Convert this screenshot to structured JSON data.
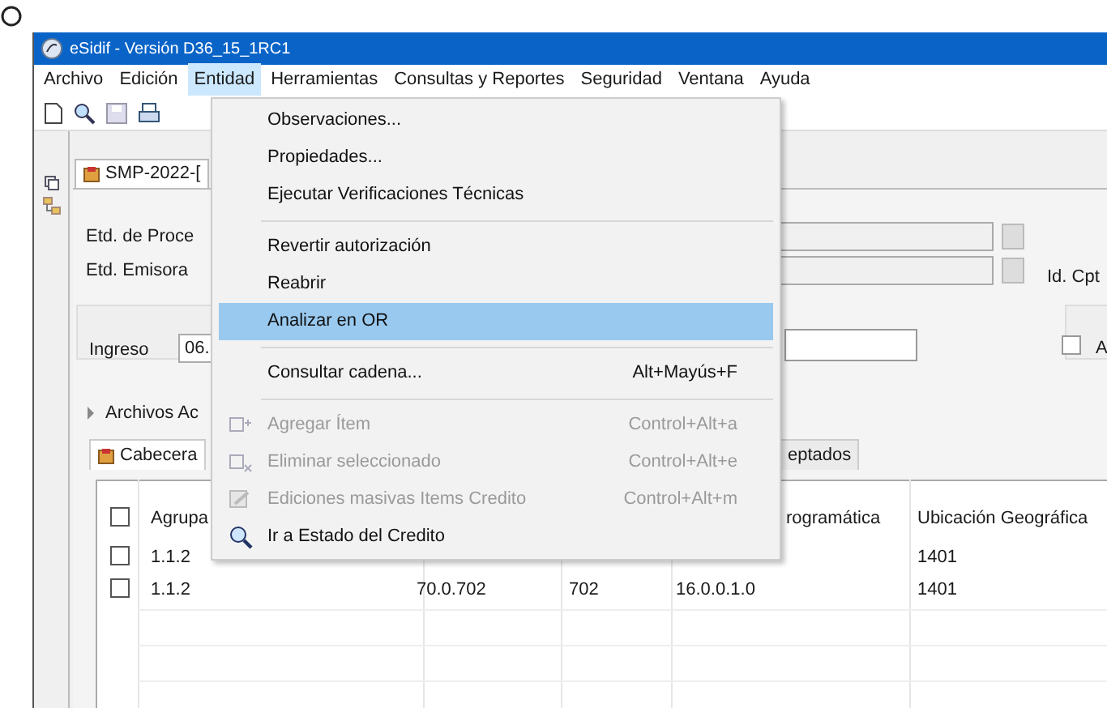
{
  "window": {
    "title": "eSidif - Versión D36_15_1RC1"
  },
  "menu_bar": [
    {
      "label": "Archivo",
      "selected": false
    },
    {
      "label": "Edición",
      "selected": false
    },
    {
      "label": "Entidad",
      "selected": true
    },
    {
      "label": "Herramientas",
      "selected": false
    },
    {
      "label": "Consultas y Reportes",
      "selected": false
    },
    {
      "label": "Seguridad",
      "selected": false
    },
    {
      "label": "Ventana",
      "selected": false
    },
    {
      "label": "Ayuda",
      "selected": false
    }
  ],
  "document_tab": {
    "label": "SMP-2022-["
  },
  "form": {
    "label_1": "Etd. de Proce",
    "label_2": "Etd. Emisora",
    "label_3": "Id. Cpt",
    "ingreso_label": "Ingreso",
    "ingreso_value": "06.",
    "checkbox": {
      "label": "A",
      "checked": false
    }
  },
  "attachments": {
    "label": "Archivos Ac",
    "expanded": false
  },
  "tabs": [
    {
      "label": "Cabecera",
      "selected": true
    },
    {
      "label": "eptados",
      "selected": false
    }
  ],
  "table": {
    "header_checked": false,
    "columns": [
      "Agrupa",
      "",
      "",
      "rogramática",
      "Ubicación Geográfica"
    ],
    "rows": [
      {
        "checked": false,
        "cells": [
          "1.1.2",
          "",
          "",
          "",
          "1401"
        ]
      },
      {
        "checked": false,
        "cells": [
          "1.1.2",
          "70.0.702",
          "702",
          "16.0.0.1.0",
          "1401"
        ]
      }
    ]
  },
  "dropdown": [
    {
      "kind": "item",
      "label": "Observaciones...",
      "selected": false,
      "disabled": false
    },
    {
      "kind": "item",
      "label": "Propiedades...",
      "selected": false,
      "disabled": false
    },
    {
      "kind": "item",
      "label": "Ejecutar Verificaciones Técnicas",
      "selected": false,
      "disabled": false
    },
    {
      "kind": "separator"
    },
    {
      "kind": "item",
      "label": "Revertir autorización",
      "selected": false,
      "disabled": false
    },
    {
      "kind": "item",
      "label": "Reabrir",
      "selected": false,
      "disabled": false
    },
    {
      "kind": "item",
      "label": "Analizar en OR",
      "selected": true,
      "disabled": false
    },
    {
      "kind": "separator"
    },
    {
      "kind": "item",
      "label": "Consultar cadena...",
      "shortcut": "Alt+Mayús+F",
      "selected": false,
      "disabled": false
    },
    {
      "kind": "separator"
    },
    {
      "kind": "item",
      "label": "Agregar Ítem",
      "shortcut": "Control+Alt+a",
      "selected": false,
      "disabled": true
    },
    {
      "kind": "item",
      "label": "Eliminar seleccionado",
      "shortcut": "Control+Alt+e",
      "selected": false,
      "disabled": true
    },
    {
      "kind": "item",
      "label": "Ediciones masivas Items Credito",
      "shortcut": "Control+Alt+m",
      "selected": false,
      "disabled": true
    },
    {
      "kind": "item",
      "label": "Ir a Estado del Credito",
      "selected": false,
      "disabled": false
    }
  ]
}
